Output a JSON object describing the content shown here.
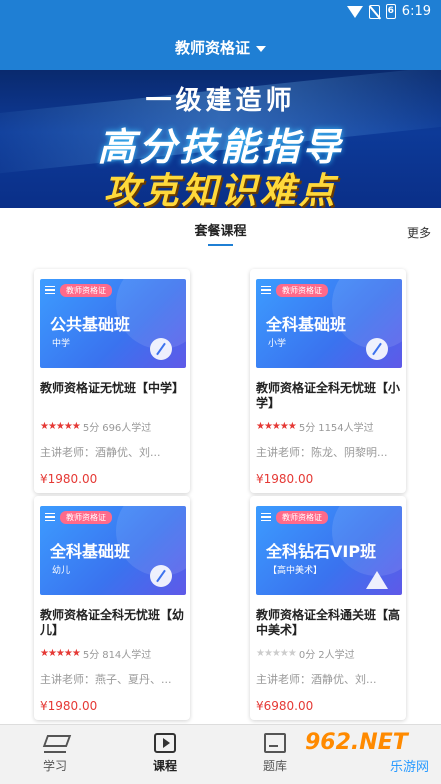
{
  "status_bar": {
    "time": "6:19",
    "battery": "6"
  },
  "header": {
    "title": "教师资格证"
  },
  "banner": {
    "line1": "一级建造师",
    "line2": "高分技能指导",
    "line3": "攻克知识难点"
  },
  "section": {
    "title": "套餐课程",
    "more": "更多"
  },
  "cards": [
    {
      "tag": "教师资格证",
      "thumb_title": "公共基础班",
      "thumb_sub": "中学",
      "title": "教师资格证无忧班【中学】",
      "score": "5分",
      "learners": "696人学过",
      "teacher": "主讲老师：酒静优、刘...",
      "price": "¥1980.00",
      "stars_filled": 5
    },
    {
      "tag": "教师资格证",
      "thumb_title": "全科基础班",
      "thumb_sub": "小学",
      "title": "教师资格证全科无忧班【小学】",
      "score": "5分",
      "learners": "1154人学过",
      "teacher": "主讲老师：陈龙、阴黎明...",
      "price": "¥1980.00",
      "stars_filled": 5
    },
    {
      "tag": "教师资格证",
      "thumb_title": "全科基础班",
      "thumb_sub": "幼儿",
      "title": "教师资格证全科无忧班【幼儿】",
      "score": "5分",
      "learners": "814人学过",
      "teacher": "主讲老师：燕子、夏丹、...",
      "price": "¥1980.00",
      "stars_filled": 5
    },
    {
      "tag": "教师资格证",
      "thumb_title": "全科钻石VIP班",
      "thumb_sub": "【高中美术】",
      "title": "教师资格证全科通关班【高中美术】",
      "score": "0分",
      "learners": "2人学过",
      "teacher": "主讲老师：酒静优、刘...",
      "price": "¥6980.00",
      "stars_filled": 0
    }
  ],
  "bottom_nav": [
    {
      "label": "学习",
      "icon": "graduation-cap-icon"
    },
    {
      "label": "课程",
      "icon": "play-icon",
      "active": true
    },
    {
      "label": "题库",
      "icon": "document-icon"
    }
  ],
  "watermark": {
    "brand": "962.NET",
    "sub": "乐游网"
  },
  "colors": {
    "primary": "#1f7fd4",
    "price": "#e53935",
    "star": "#e53935"
  }
}
